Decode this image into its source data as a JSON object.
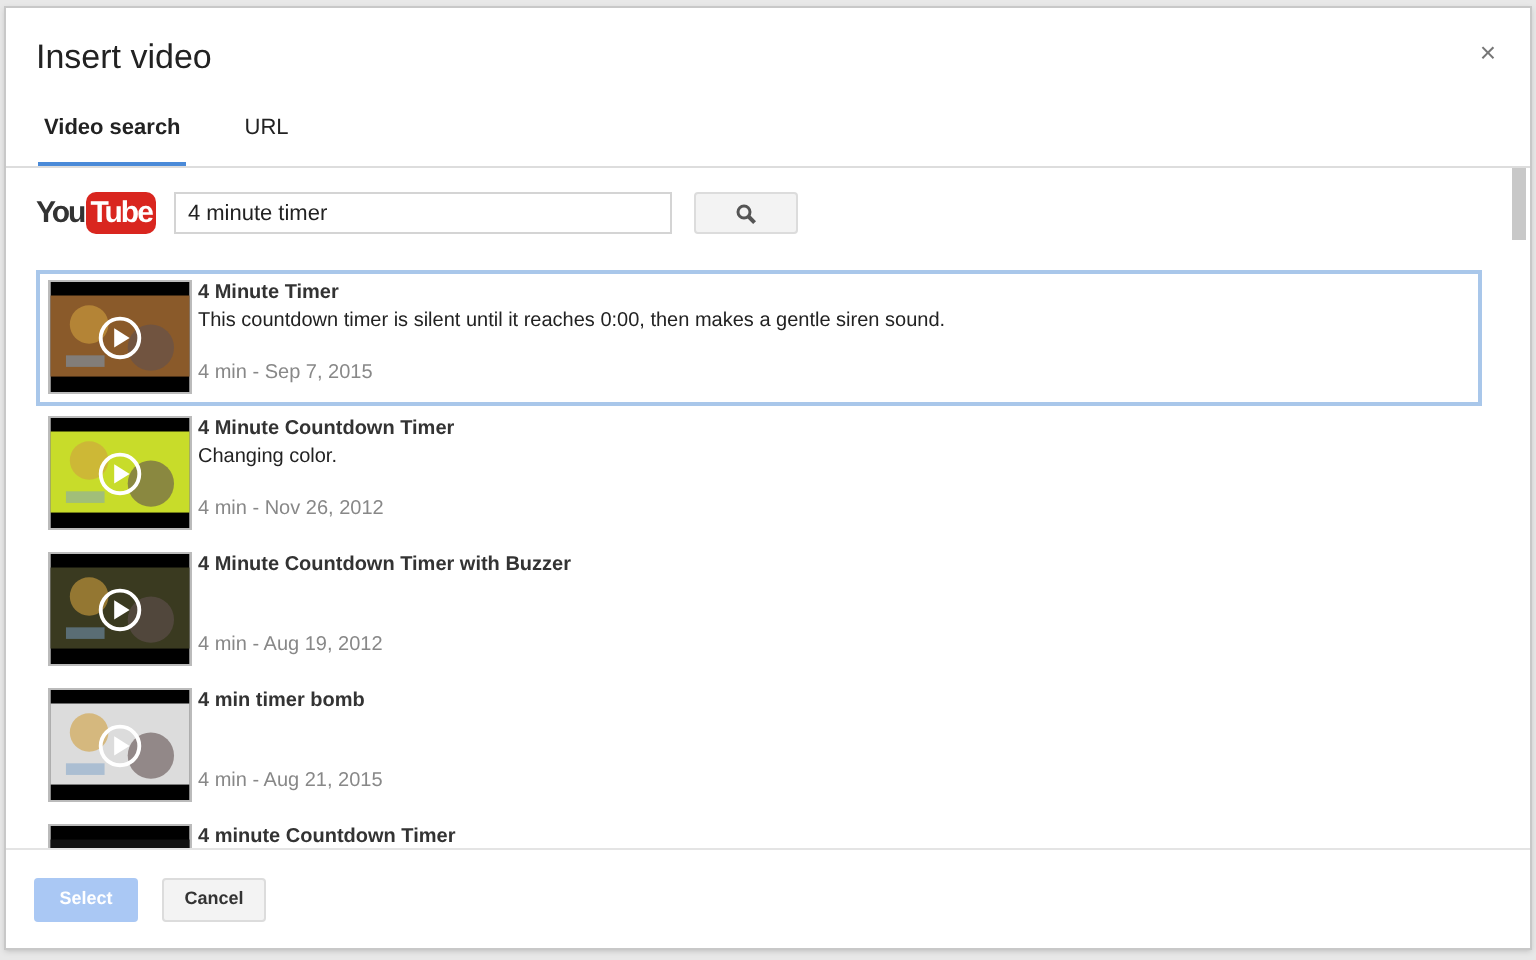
{
  "dialog": {
    "title": "Insert video",
    "close": "×"
  },
  "tabs": [
    {
      "label": "Video search",
      "selected": true
    },
    {
      "label": "URL",
      "selected": false
    }
  ],
  "search": {
    "logo": [
      "You",
      "Tube"
    ],
    "value": "4 minute timer"
  },
  "results": [
    {
      "title": "4 Minute Timer",
      "description": "This countdown timer is silent until it reaches 0:00, then makes a gentle siren sound.",
      "meta": "4 min - Sep 7, 2015",
      "selected": true
    },
    {
      "title": "4 Minute Countdown Timer",
      "description": "Changing color.",
      "meta": "4 min - Nov 26, 2012",
      "selected": false
    },
    {
      "title": "4 Minute Countdown Timer with Buzzer",
      "meta": "4 min - Aug 19, 2012",
      "selected": false
    },
    {
      "title": "4 min timer bomb",
      "meta": "4 min - Aug 21, 2015",
      "selected": false
    },
    {
      "title": "4 minute Countdown Timer",
      "selected": false
    }
  ],
  "buttons": [
    {
      "label": "Select",
      "kind": "primary",
      "disabled": true
    },
    {
      "label": "Cancel",
      "kind": "secondary",
      "disabled": false
    }
  ]
}
